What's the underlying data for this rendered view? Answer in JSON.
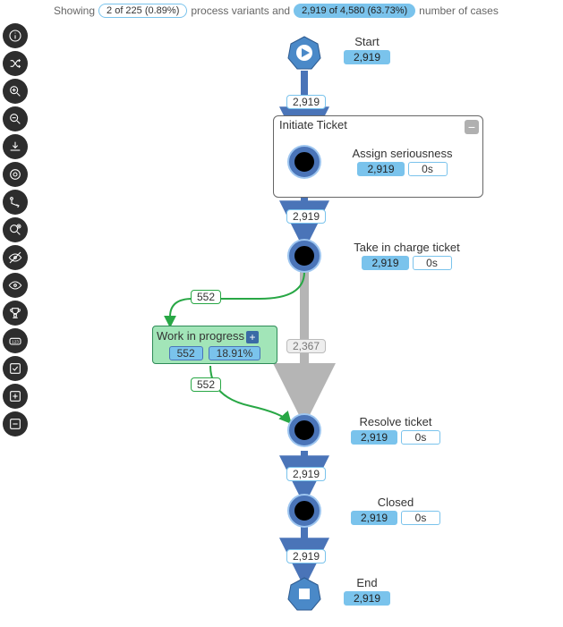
{
  "header": {
    "showing": "Showing",
    "variants_pill": "2 of 225 (0.89%)",
    "mid": "process variants and",
    "cases_pill": "2,919 of 4,580 (63.73%)",
    "tail": "number of cases"
  },
  "toolbar_icons": [
    "info-icon",
    "shuffle-icon",
    "zoom-in-icon",
    "zoom-out-icon",
    "download-svg-icon",
    "target-icon",
    "vector-icon",
    "add-filter-icon",
    "view-1-icon",
    "view-2-icon",
    "trophy-icon",
    "counter-icon",
    "checkbox-icon",
    "add-panel-icon",
    "remove-panel-icon"
  ],
  "group": {
    "title": "Initiate Ticket"
  },
  "nodes": {
    "start": {
      "label": "Start",
      "count": "2,919"
    },
    "assign": {
      "label": "Assign seriousness",
      "count": "2,919",
      "time": "0s"
    },
    "take": {
      "label": "Take in charge ticket",
      "count": "2,919",
      "time": "0s"
    },
    "wip": {
      "label": "Work in progress",
      "count": "552",
      "pct": "18.91%"
    },
    "resolve": {
      "label": "Resolve ticket",
      "count": "2,919",
      "time": "0s"
    },
    "closed": {
      "label": "Closed",
      "count": "2,919",
      "time": "0s"
    },
    "end": {
      "label": "End",
      "count": "2,919"
    }
  },
  "edges": {
    "start_assign": "2,919",
    "assign_take": "2,919",
    "take_resolve_gray": "2,367",
    "take_wip": "552",
    "wip_resolve": "552",
    "resolve_closed": "2,919",
    "closed_end": "2,919"
  }
}
